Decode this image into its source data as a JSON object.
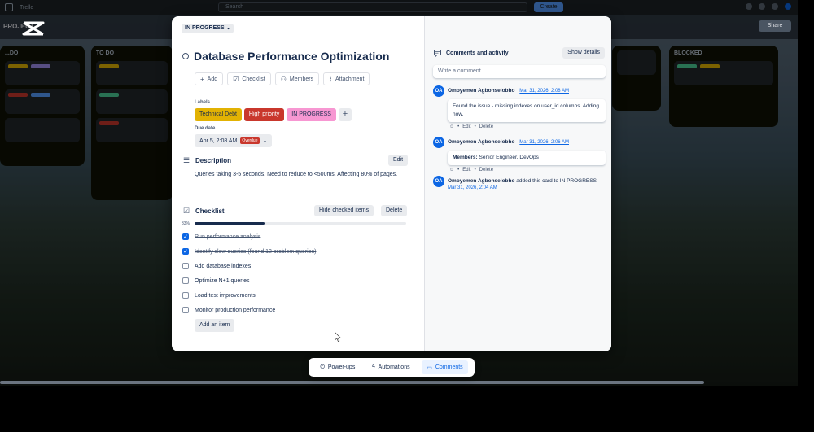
{
  "topbar": {
    "app_name": "Trello",
    "search_placeholder": "Search",
    "create_label": "Create"
  },
  "board": {
    "name": "PROJECT",
    "share_label": "Share",
    "lists": [
      {
        "title": "...DO"
      },
      {
        "title": "TO DO"
      },
      {
        "title": "BLOCKED"
      }
    ]
  },
  "card": {
    "status": "IN PROGRESS",
    "title": "Database Performance Optimization",
    "actions": {
      "add": "Add",
      "checklist": "Checklist",
      "members": "Members",
      "attachment": "Attachment"
    },
    "labels_heading": "Labels",
    "labels": [
      {
        "text": "Technical Debt",
        "bg": "#e2b203",
        "fg": "#172b4d"
      },
      {
        "text": "High priority",
        "bg": "#c9372c",
        "fg": "#ffffff"
      },
      {
        "text": "IN PROGRESS",
        "bg": "#f797d2",
        "fg": "#172b4d"
      }
    ],
    "due_heading": "Due date",
    "due_date": "Apr 5, 2:08 AM",
    "due_badge": "Overdue",
    "description_heading": "Description",
    "edit_label": "Edit",
    "description": "Queries taking 3-5 seconds. Need to reduce to <500ms. Affecting 80% of pages.",
    "checklist_heading": "Checklist",
    "hide_checked_label": "Hide checked items",
    "delete_label": "Delete",
    "progress_percent": 33,
    "progress_label": "33%",
    "checklist": [
      {
        "text": "Run performance analysis",
        "done": true
      },
      {
        "text": "Identify slow queries (found 12 problem queries)",
        "done": true
      },
      {
        "text": "Add database indexes",
        "done": false
      },
      {
        "text": "Optimize N+1 queries",
        "done": false
      },
      {
        "text": "Load test improvements",
        "done": false
      },
      {
        "text": "Monitor production performance",
        "done": false
      }
    ],
    "add_item_label": "Add an item"
  },
  "activity_panel": {
    "title": "Comments and activity",
    "show_details": "Show details",
    "comment_placeholder": "Write a comment...",
    "items": [
      {
        "initials": "OA",
        "name": "Omoyemen Agbonselobho",
        "time": "Mar 31, 2026, 2:08 AM",
        "body": "Found the issue - missing indexes on user_id columns. Adding now.",
        "edit": "Edit",
        "delete": "Delete"
      },
      {
        "initials": "OA",
        "name": "Omoyemen Agbonselobho",
        "time": "Mar 31, 2026, 2:06 AM",
        "members_prefix": "Members:",
        "members_value": "Senior Engineer, DevOps",
        "edit": "Edit",
        "delete": "Delete"
      },
      {
        "initials": "OA",
        "name": "Omoyemen Agbonselobho",
        "action": "added this card to IN PROGRESS",
        "time": "Mar 31, 2026, 2:04 AM"
      }
    ]
  },
  "bottombar": {
    "powerups": "Power-ups",
    "automations": "Automations",
    "comments": "Comments"
  }
}
